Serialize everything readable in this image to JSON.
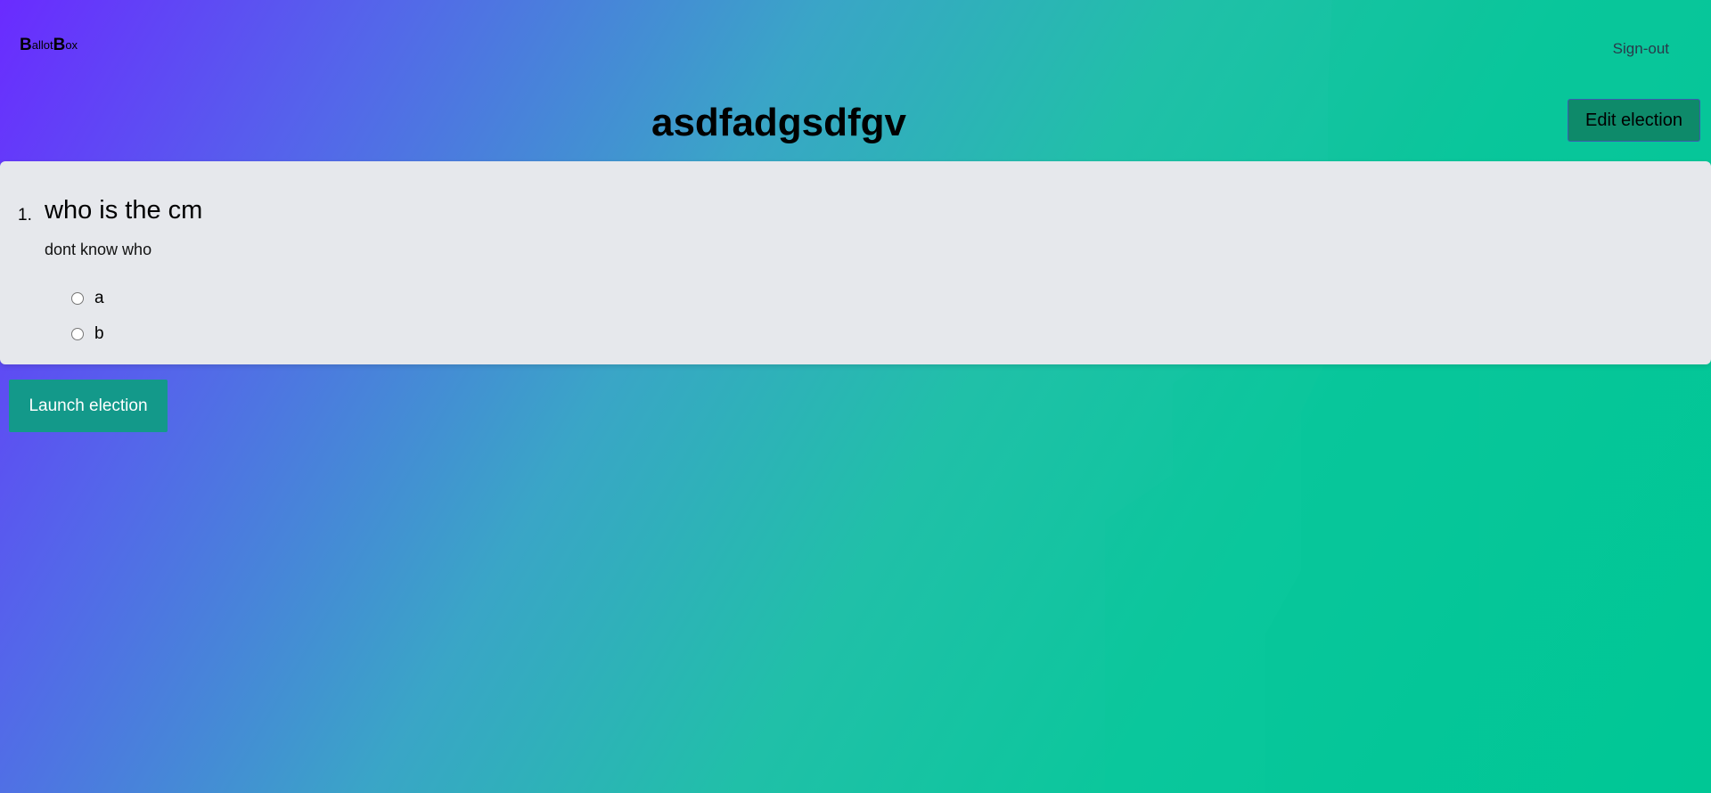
{
  "nav": {
    "brand_b1": "B",
    "brand_part1": "allot",
    "brand_b2": "B",
    "brand_part2": "ox",
    "signout_label": "Sign-out"
  },
  "election": {
    "title": "asdfadgsdfgv",
    "edit_label": "Edit election",
    "launch_label": "Launch election"
  },
  "questions": [
    {
      "number": "1.",
      "title": "who is the cm",
      "description": "dont know who",
      "options": [
        "a",
        "b"
      ]
    }
  ]
}
